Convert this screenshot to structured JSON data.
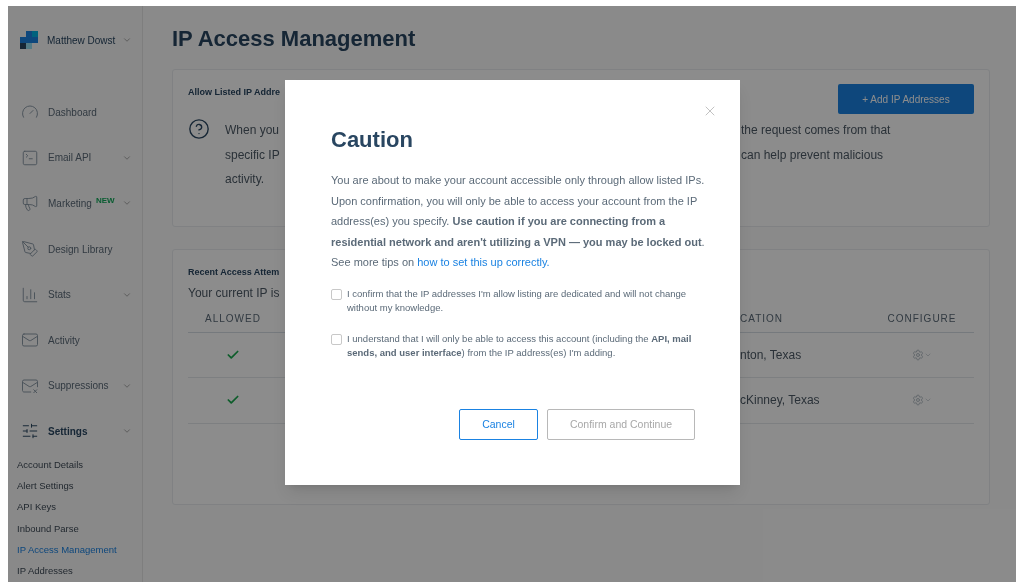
{
  "sidebar": {
    "user": {
      "name": "Matthew Dowst"
    },
    "items": [
      {
        "label": "Dashboard",
        "expandable": false,
        "active": false
      },
      {
        "label": "Email API",
        "expandable": true,
        "active": false
      },
      {
        "label": "Marketing",
        "badge": "NEW",
        "expandable": true,
        "active": false
      },
      {
        "label": "Design Library",
        "expandable": false,
        "active": false
      },
      {
        "label": "Stats",
        "expandable": true,
        "active": false
      },
      {
        "label": "Activity",
        "expandable": false,
        "active": false
      },
      {
        "label": "Suppressions",
        "expandable": true,
        "active": false
      },
      {
        "label": "Settings",
        "expandable": true,
        "active": true,
        "children": [
          {
            "label": "Account Details",
            "selected": false
          },
          {
            "label": "Alert Settings",
            "selected": false
          },
          {
            "label": "API Keys",
            "selected": false
          },
          {
            "label": "Inbound Parse",
            "selected": false
          },
          {
            "label": "IP Access Management",
            "selected": true
          },
          {
            "label": "IP Addresses",
            "selected": false
          }
        ]
      }
    ]
  },
  "page": {
    "title": "IP Access Management",
    "allow_card": {
      "title": "Allow Listed IP Addre",
      "button": "+ Add IP Addresses",
      "text_left": [
        "When you",
        "specific IP",
        "activity."
      ],
      "text_right": [
        "the request comes from that",
        "can help prevent malicious"
      ]
    },
    "recent_card": {
      "title": "Recent Access Attem",
      "current_ip": "Your current IP is",
      "columns": [
        "ALLOWED",
        "CATION",
        "CONFIGURE"
      ],
      "rows": [
        {
          "allowed": true,
          "location": "nton, Texas"
        },
        {
          "allowed": true,
          "location": "cKinney, Texas"
        }
      ]
    }
  },
  "modal": {
    "title": "Caution",
    "body": "You are about to make your account accessible only through allow listed IPs. Upon confirmation, you will only be able to access your account from the IP address(es) you specify. **Use caution if you are connecting from a residential network and aren't utilizing a VPN — you may be locked out**. See more tips on",
    "link": "how to set this up correctly.",
    "checkboxes": [
      {
        "label": "I confirm that the IP addresses I'm allow listing are dedicated and will not change without my knowledge.",
        "checked": false
      },
      {
        "label": "I understand that I will only be able to access this account (including the **API, mail sends, and user interface**) from the IP address(es) I'm adding.",
        "checked": false
      }
    ],
    "buttons": [
      {
        "label": "Cancel",
        "kind": "secondary",
        "disabled": false
      },
      {
        "label": "Confirm and Continue",
        "kind": "primary",
        "disabled": true
      }
    ]
  }
}
